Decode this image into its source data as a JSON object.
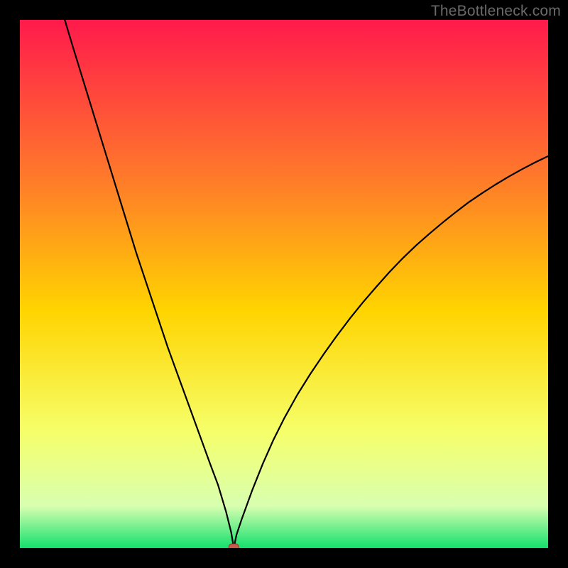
{
  "watermark": "TheBottleneck.com",
  "colors": {
    "frame": "#000000",
    "gradient_top": "#ff1a4c",
    "gradient_mid_top": "#ff7a2a",
    "gradient_mid": "#ffd400",
    "gradient_mid_low": "#f6ff6a",
    "gradient_low": "#d8ffb0",
    "gradient_bottom": "#13e06d",
    "curve": "#000000",
    "marker_fill": "#c65b4b",
    "marker_stroke": "#8c3a2f"
  },
  "chart_data": {
    "type": "line",
    "title": "",
    "xlabel": "",
    "ylabel": "",
    "xlim": [
      0,
      100
    ],
    "ylim": [
      0,
      100
    ],
    "marker": {
      "x": 40.5,
      "y": 0
    },
    "series": [
      {
        "name": "curve",
        "x": [
          8.5,
          10,
          12,
          14,
          16,
          18,
          20,
          22,
          24,
          26,
          28,
          30,
          32,
          34,
          36,
          37.5,
          39,
          40,
          40.5,
          41,
          42,
          44,
          46,
          48,
          50,
          52.5,
          55,
          57.5,
          60,
          62.5,
          65,
          67.5,
          70,
          72.5,
          75,
          77.5,
          80,
          82.5,
          85,
          87.5,
          90,
          92.5,
          95,
          97.5,
          100
        ],
        "y": [
          100,
          95,
          88.5,
          82,
          75.5,
          69,
          62.5,
          56,
          50,
          44,
          38,
          32.5,
          27,
          21.5,
          16,
          12,
          7,
          3,
          0,
          2.5,
          5.5,
          11,
          16,
          20.5,
          24.5,
          29,
          33,
          36.7,
          40.2,
          43.5,
          46.6,
          49.5,
          52.3,
          54.9,
          57.3,
          59.5,
          61.6,
          63.6,
          65.5,
          67.2,
          68.8,
          70.3,
          71.7,
          73,
          74.2
        ]
      }
    ]
  }
}
